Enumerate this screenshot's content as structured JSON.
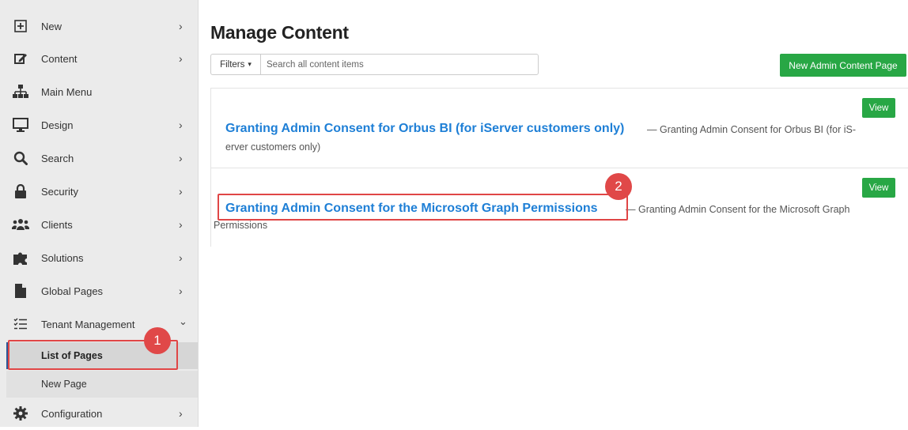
{
  "sidebar": {
    "items": [
      {
        "label": "New",
        "icon": "plus-square-icon",
        "chevron": "›"
      },
      {
        "label": "Content",
        "icon": "edit-icon",
        "chevron": "›"
      },
      {
        "label": "Main Menu",
        "icon": "sitemap-icon",
        "chevron": ""
      },
      {
        "label": "Design",
        "icon": "desktop-icon",
        "chevron": "›"
      },
      {
        "label": "Search",
        "icon": "search-icon",
        "chevron": "›"
      },
      {
        "label": "Security",
        "icon": "lock-icon",
        "chevron": "›"
      },
      {
        "label": "Clients",
        "icon": "users-icon",
        "chevron": "›"
      },
      {
        "label": "Solutions",
        "icon": "puzzle-icon",
        "chevron": "›"
      },
      {
        "label": "Global Pages",
        "icon": "file-icon",
        "chevron": "›"
      },
      {
        "label": "Tenant Management",
        "icon": "tasks-icon",
        "chevron": "⌄"
      },
      {
        "label": "Configuration",
        "icon": "gear-icon",
        "chevron": "›"
      }
    ],
    "sub_items": [
      {
        "label": "List of Pages",
        "active": true
      },
      {
        "label": "New Page",
        "active": false
      }
    ]
  },
  "main": {
    "title": "Manage Content",
    "filters_label": "Filters",
    "filters_caret": "▾",
    "search_placeholder": "Search all content items",
    "new_button": "New Admin Content Page",
    "results": [
      {
        "title": "Granting Admin Consent for Orbus BI (for iServer customers only)",
        "desc_line1": "— Granting Admin Consent for Orbus BI (for iS-",
        "desc_line2": "erver customers only)",
        "view_label": "View"
      },
      {
        "title": "Granting Admin Consent for the Microsoft Graph Permissions",
        "desc_line1": "— Granting Admin Consent for the Microsoft Graph",
        "desc_line2": "Permissions",
        "view_label": "View"
      }
    ]
  },
  "callouts": {
    "one": "1",
    "two": "2"
  },
  "colors": {
    "accent_green": "#28a745",
    "link_blue": "#1e7fd6",
    "callout_red": "#e04646",
    "active_border": "#2b5797"
  }
}
